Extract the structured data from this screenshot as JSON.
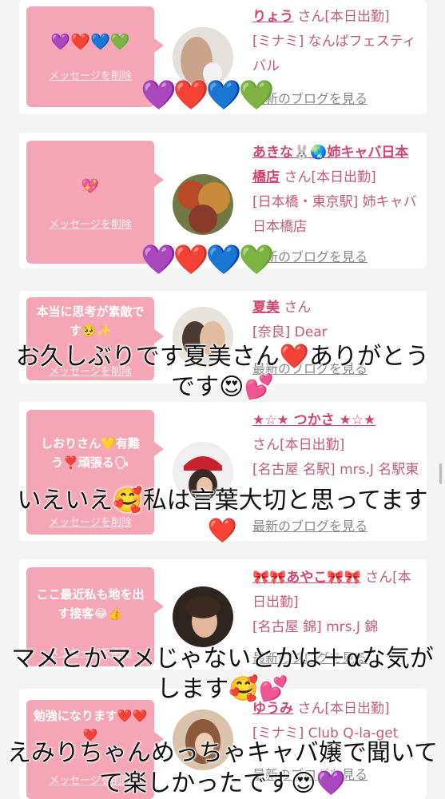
{
  "delete_label": "メッセージを削除",
  "blog_label": "最新のブログを見る",
  "cards": [
    {
      "message": "💜❤️💙💚",
      "name": "りょう",
      "san": "さん[本日出勤]",
      "shop": "[ミナミ] なんばフェスティバル",
      "avatar_color": "#cfcfcf"
    },
    {
      "message": "💖",
      "name": "あきな🐰🌏姉キャバ日本橋店",
      "san": "さん[本日出勤]",
      "shop": "[日本橋・東京駅] 姉キャバ 日本橋店",
      "avatar_color": "#8a5a3a"
    },
    {
      "message": "本当に思考が素敵です🥺✨",
      "name": "夏美",
      "san": "さん",
      "shop": "[奈良] Dear",
      "avatar_color": "#b59b7a"
    },
    {
      "message": "しおりさん💛有難う❣️頑張る🗣",
      "name": "★☆★ つかさ ★☆★",
      "san": "さん[本日出勤]",
      "shop": "[名古屋 名駅] mrs.J 名駅東",
      "avatar_color": "#6a4a3a"
    },
    {
      "message": "ここ最近私も地を出す接客😂👍",
      "name": "🎀🎀あやこ🎀🎀",
      "san": "さん[本日出勤]",
      "shop": "[名古屋 錦] mrs.J 錦",
      "avatar_color": "#4a3a30"
    },
    {
      "message": "勉強になります❤️❤️❤️",
      "name": "ゆうみ",
      "san": "さん[本日出勤]",
      "shop": "[ミナミ] Club Q-la-get",
      "avatar_color": "#9c7a60"
    }
  ],
  "stickers": {
    "hearts_1": "💜❤️💙💚",
    "hearts_2": "💜❤️💙💚"
  },
  "captions": [
    "お久しぶりです夏美さん❤️ありがとうです😍💕",
    "いえいえ🥰私は言葉大切と思ってます❤️",
    "マメとかマメじゃないとかは＋αな気がします🥰💕",
    "えみりちゃんめっちゃキャバ嬢で聞いてて楽しかったです😍💜"
  ]
}
